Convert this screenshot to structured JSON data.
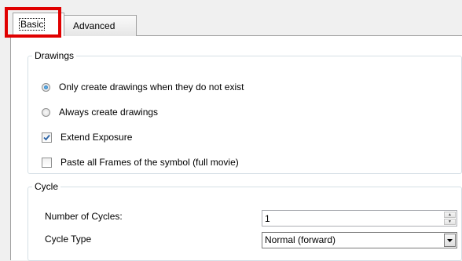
{
  "tabs": [
    {
      "label": "Basic",
      "active": true
    },
    {
      "label": "Advanced",
      "active": false
    }
  ],
  "drawings": {
    "legend": "Drawings",
    "options": [
      {
        "label": "Only create drawings when they do not exist",
        "type": "radio",
        "checked": true
      },
      {
        "label": "Always create drawings",
        "type": "radio",
        "checked": false
      },
      {
        "label": "Extend Exposure",
        "type": "checkbox",
        "checked": true
      },
      {
        "label": "Paste all Frames of the symbol (full movie)",
        "type": "checkbox",
        "checked": false
      }
    ]
  },
  "cycle": {
    "legend": "Cycle",
    "number_label": "Number of Cycles:",
    "number_value": "1",
    "type_label": "Cycle Type",
    "type_value": "Normal (forward)"
  },
  "colors": {
    "highlight": "#e00000",
    "radio_accent": "#1a5fa8",
    "check_accent": "#2a62a6"
  }
}
